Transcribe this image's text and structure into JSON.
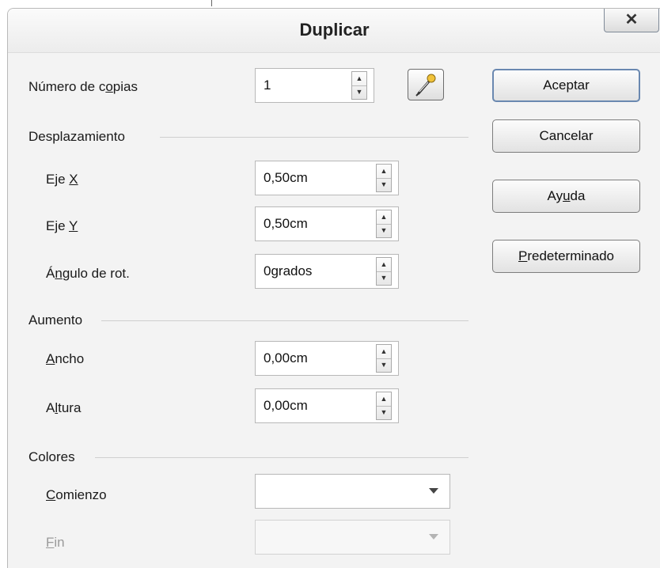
{
  "window": {
    "title": "Duplicar",
    "close_label": "✕"
  },
  "copies": {
    "label_pre": "Número de c",
    "label_u": "o",
    "label_post": "pias",
    "value": "1"
  },
  "sections": {
    "displacement": "Desplazamiento",
    "enlargement": "Aumento",
    "colors": "Colores"
  },
  "displacement": {
    "x_pre": "Eje ",
    "x_u": "X",
    "x_value": "0,50cm",
    "y_pre": "Eje ",
    "y_u": "Y",
    "y_value": "0,50cm",
    "angle_pre": "Á",
    "angle_u": "n",
    "angle_post": "gulo de rot.",
    "angle_value": "0grados"
  },
  "enlargement": {
    "width_u": "A",
    "width_post": "ncho",
    "width_value": "0,00cm",
    "height_pre": "A",
    "height_u": "l",
    "height_post": "tura",
    "height_value": "0,00cm"
  },
  "colors": {
    "start_u": "C",
    "start_post": "omienzo",
    "start_value": "",
    "end_u": "F",
    "end_post": "in",
    "end_value": ""
  },
  "buttons": {
    "ok": "Aceptar",
    "cancel": "Cancelar",
    "help_pre": "Ay",
    "help_u": "u",
    "help_post": "da",
    "default_u": "P",
    "default_post": "redeterminado"
  },
  "icons": {
    "picker": "eyedropper-icon",
    "spin_up": "triangle-up",
    "spin_down": "triangle-down",
    "dropdown": "triangle-down"
  }
}
